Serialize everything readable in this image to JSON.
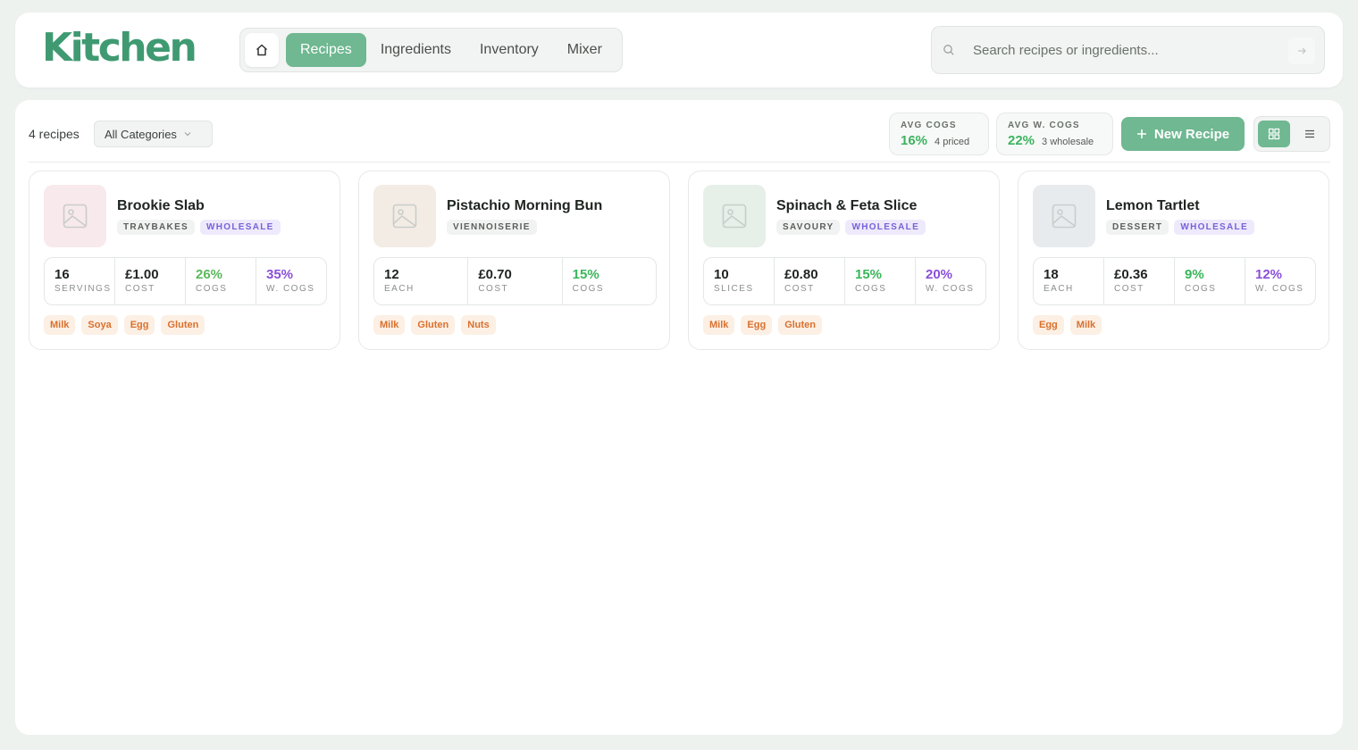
{
  "header": {
    "logo": "Kitchen",
    "nav": [
      {
        "label": "Recipes",
        "active": true
      },
      {
        "label": "Ingredients",
        "active": false
      },
      {
        "label": "Inventory",
        "active": false
      },
      {
        "label": "Mixer",
        "active": false
      }
    ],
    "search": {
      "placeholder": "Search recipes or ingredients..."
    }
  },
  "toolbar": {
    "count": "4 recipes",
    "category_select": "All Categories",
    "avg_cogs": {
      "label": "AVG COGS",
      "value": "16%",
      "sub": "4 priced"
    },
    "avg_wcogs": {
      "label": "AVG W. COGS",
      "value": "22%",
      "sub": "3 wholesale"
    },
    "new_recipe": "New Recipe"
  },
  "colors": {
    "brand": "#3f9a72",
    "accent": "#6fb891",
    "cogs_green": "#5cb85c",
    "wcogs_purple": "#8a4fd9",
    "allergen_bg": "#fcefe4",
    "allergen_fg": "#d9712e"
  },
  "recipes": [
    {
      "title": "Brookie Slab",
      "category": "TRAYBAKES",
      "wholesale": "WHOLESALE",
      "thumb_color": "#f8e9ec",
      "metrics": [
        {
          "value": "16",
          "label": "SERVINGS",
          "style": ""
        },
        {
          "value": "£1.00",
          "label": "COST",
          "style": ""
        },
        {
          "value": "26%",
          "label": "COGS",
          "style": "green"
        },
        {
          "value": "35%",
          "label": "W. COGS",
          "style": "purple"
        }
      ],
      "allergens": [
        "Milk",
        "Soya",
        "Egg",
        "Gluten"
      ]
    },
    {
      "title": "Pistachio Morning Bun",
      "category": "VIENNOISERIE",
      "wholesale": "",
      "thumb_color": "#f3ece4",
      "metrics": [
        {
          "value": "12",
          "label": "EACH",
          "style": ""
        },
        {
          "value": "£0.70",
          "label": "COST",
          "style": ""
        },
        {
          "value": "15%",
          "label": "COGS",
          "style": "green2"
        }
      ],
      "allergens": [
        "Milk",
        "Gluten",
        "Nuts"
      ]
    },
    {
      "title": "Spinach & Feta Slice",
      "category": "SAVOURY",
      "wholesale": "WHOLESALE",
      "thumb_color": "#e6efe8",
      "metrics": [
        {
          "value": "10",
          "label": "SLICES",
          "style": ""
        },
        {
          "value": "£0.80",
          "label": "COST",
          "style": ""
        },
        {
          "value": "15%",
          "label": "COGS",
          "style": "green2"
        },
        {
          "value": "20%",
          "label": "W. COGS",
          "style": "purple"
        }
      ],
      "allergens": [
        "Milk",
        "Egg",
        "Gluten"
      ]
    },
    {
      "title": "Lemon Tartlet",
      "category": "DESSERT",
      "wholesale": "WHOLESALE",
      "thumb_color": "#e8ebee",
      "metrics": [
        {
          "value": "18",
          "label": "EACH",
          "style": ""
        },
        {
          "value": "£0.36",
          "label": "COST",
          "style": ""
        },
        {
          "value": "9%",
          "label": "COGS",
          "style": "green2"
        },
        {
          "value": "12%",
          "label": "W. COGS",
          "style": "purple"
        }
      ],
      "allergens": [
        "Egg",
        "Milk"
      ]
    }
  ]
}
